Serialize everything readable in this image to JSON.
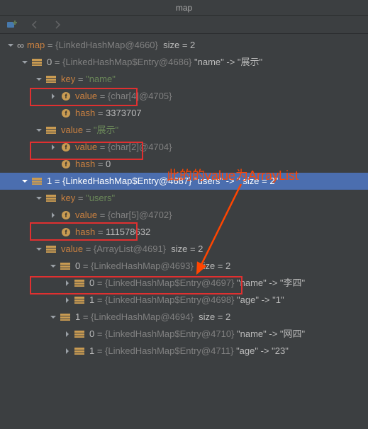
{
  "titlebar": "map",
  "annotation_text": "此的的value为ArrayList",
  "root": {
    "name": "map",
    "eq_type": "{LinkedHashMap@4660}",
    "size": "size = 2"
  },
  "e0": {
    "idx": "0",
    "type": "{LinkedHashMap$Entry@4686}",
    "mapping": "\"name\" -> \"展示\""
  },
  "e0_key": {
    "label": "key",
    "value": "\"name\""
  },
  "e0_key_value": {
    "label": "value",
    "type": "{char[4]@4705}"
  },
  "e0_key_hash": {
    "label": "hash",
    "value": "3373707"
  },
  "e0_val": {
    "label": "value",
    "value": "\"展示\""
  },
  "e0_val_value": {
    "label": "value",
    "type": "{char[2]@4704}"
  },
  "e0_val_hash": {
    "label": "hash",
    "value": "0"
  },
  "e1": {
    "idx": "1",
    "type": "{LinkedHashMap$Entry@4687}",
    "mapping": "\"users\" -> \" size = 2\""
  },
  "e1_key": {
    "label": "key",
    "value": "\"users\""
  },
  "e1_key_value": {
    "label": "value",
    "type": "{char[5]@4702}"
  },
  "e1_key_hash": {
    "label": "hash",
    "value": "111578632"
  },
  "e1_val": {
    "label": "value",
    "type": "{ArrayList@4691}",
    "size": "size = 2"
  },
  "e1_v0": {
    "idx": "0",
    "type": "{LinkedHashMap@4693}",
    "size": "size = 2"
  },
  "e1_v0_0": {
    "idx": "0",
    "type": "{LinkedHashMap$Entry@4697}",
    "mapping": "\"name\" -> \"李四\""
  },
  "e1_v0_1": {
    "idx": "1",
    "type": "{LinkedHashMap$Entry@4698}",
    "mapping": "\"age\" -> \"1\""
  },
  "e1_v1": {
    "idx": "1",
    "type": "{LinkedHashMap@4694}",
    "size": "size = 2"
  },
  "e1_v1_0": {
    "idx": "0",
    "type": "{LinkedHashMap$Entry@4710}",
    "mapping": "\"name\" -> \"网四\""
  },
  "e1_v1_1": {
    "idx": "1",
    "type": "{LinkedHashMap$Entry@4711}",
    "mapping": "\"age\" -> \"23\""
  }
}
